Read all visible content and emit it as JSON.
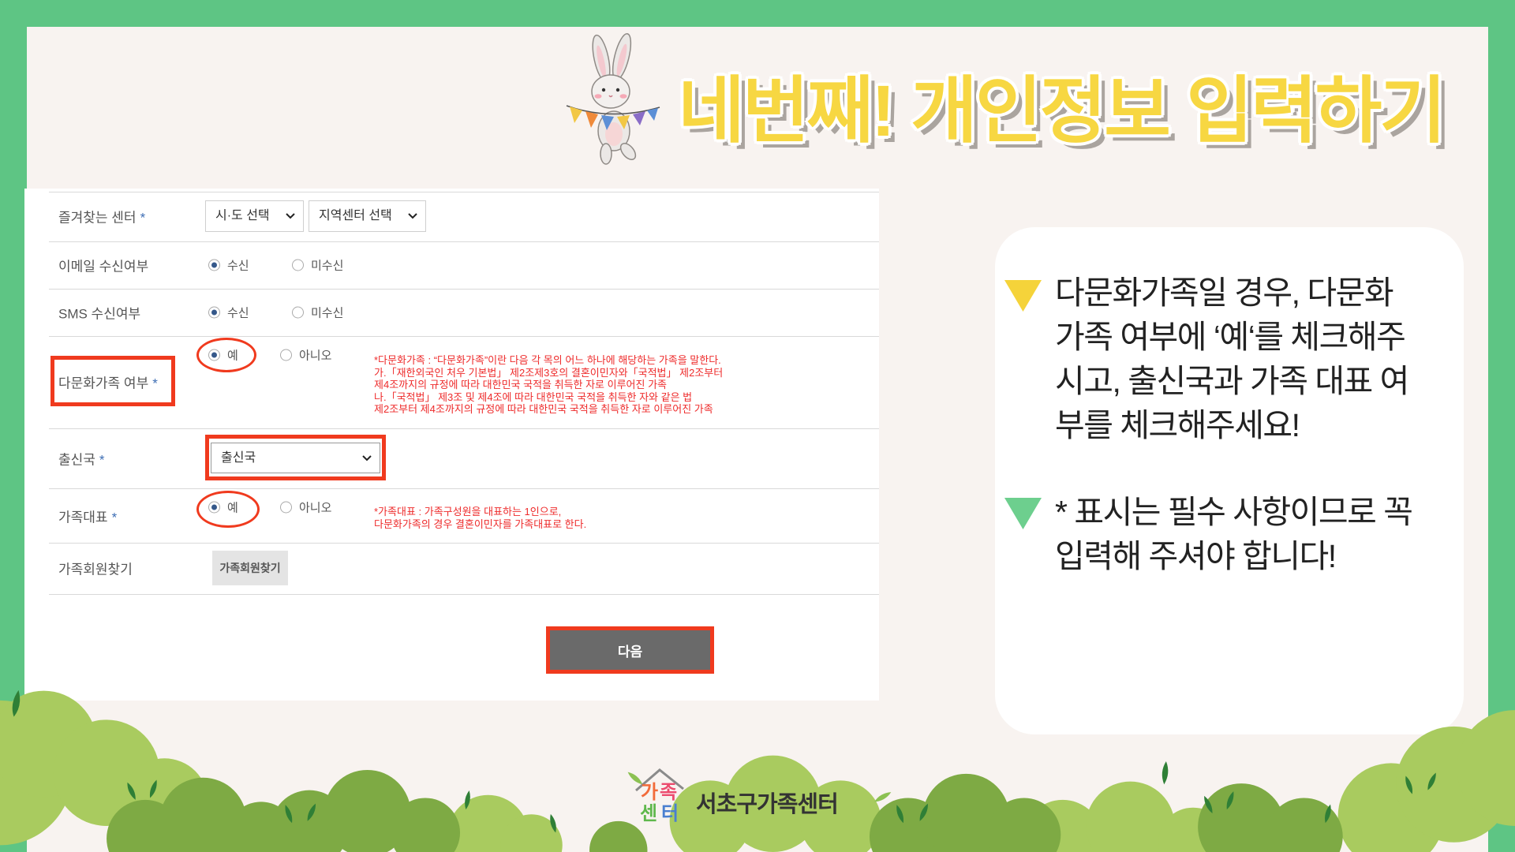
{
  "colors": {
    "frame": "#5ec584",
    "background": "#f8f3f0",
    "title": "#f7d742",
    "highlight": "#f03a1e",
    "note_text": "#ee2b2b",
    "required_mark": "#3f6fb5",
    "radio_checked": "#35588a",
    "next_button": "#6a6a6a",
    "bullet_1": "#f5d33a",
    "bullet_2": "#6dcf8e"
  },
  "icons": {
    "illustration": "bunny-with-bunting",
    "select_arrow": "chevron-down-icon",
    "bullet": "triangle-down-icon",
    "logo": "house-icon"
  },
  "title": "네번째! 개인정보 입력하기",
  "form": {
    "favorite_center": {
      "label": "즐겨찾는 센터",
      "required": "*",
      "select_sido": "시·도 선택",
      "select_center": "지역센터 선택"
    },
    "email": {
      "label": "이메일 수신여부",
      "option_yes": "수신",
      "option_no": "미수신",
      "selected": "수신"
    },
    "sms": {
      "label": "SMS 수신여부",
      "option_yes": "수신",
      "option_no": "미수신",
      "selected": "수신"
    },
    "multicultural": {
      "label": "다문화가족 여부",
      "required": "*",
      "option_yes": "예",
      "option_no": "아니오",
      "selected": "예",
      "note": [
        "*다문화가족 : “다문화가족”이란 다음 각 목의 어느 하나에 해당하는 가족을 말한다.",
        "가.「재한외국인 처우 기본법」 제2조제3호의 결혼이민자와「국적법」 제2조부터",
        "제4조까지의 규정에 따라 대한민국 국적을 취득한 자로 이루어진 가족",
        "나.「국적법」 제3조 및 제4조에 따라 대한민국 국적을 취득한 자와 같은 법",
        "제2조부터 제4조까지의 규정에 따라 대한민국 국적을 취득한 자로 이루어진 가족"
      ]
    },
    "country": {
      "label": "출신국",
      "required": "*",
      "select_value": "출신국"
    },
    "family_rep": {
      "label": "가족대표",
      "required": "*",
      "option_yes": "예",
      "option_no": "아니오",
      "selected": "예",
      "note": [
        "*가족대표 : 가족구성원을 대표하는 1인으로,",
        "다문화가족의 경우 결혼이민자를 가족대표로 한다."
      ]
    },
    "family_search": {
      "label": "가족회원찾기",
      "button": "가족회원찾기"
    },
    "next_button": "다음"
  },
  "info_box": {
    "bullet_1": [
      "다문화가족일 경우, 다문화",
      "가족 여부에 ‘예‘를 체크해주",
      "시고, 출신국과 가족 대표 여",
      "부를 체크해주세요!"
    ],
    "bullet_2": [
      "* 표시는 필수 사항이므로 꼭",
      "입력해 주셔야 합니다!"
    ]
  },
  "logo": {
    "mark_letters": [
      "가",
      "족",
      "센",
      "터"
    ],
    "mark_colors": [
      "#f26b3a",
      "#ec4b6e",
      "#5fb84c",
      "#4a7fd0"
    ],
    "name": "서초구가족센터"
  }
}
